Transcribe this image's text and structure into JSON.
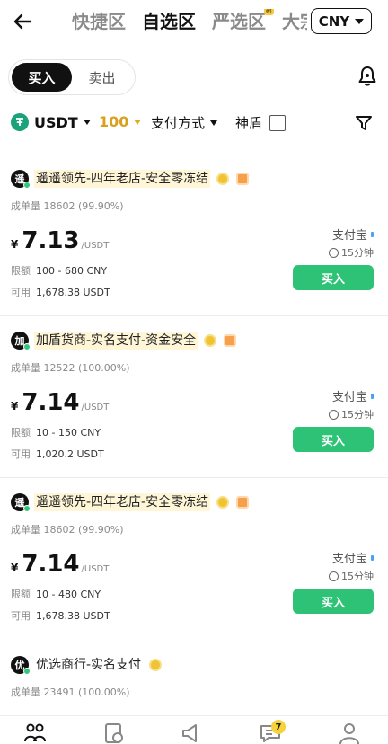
{
  "header": {
    "tabs": [
      {
        "label": "快捷区",
        "active": false
      },
      {
        "label": "自选区",
        "active": true
      },
      {
        "label": "严选区",
        "active": false,
        "badge": "新"
      },
      {
        "label": "大宗",
        "active": false
      }
    ],
    "currency": "CNY"
  },
  "trade_toggle": {
    "buy": "买入",
    "sell": "卖出",
    "selected": "买入"
  },
  "filters": {
    "coin": "USDT",
    "amount": "100",
    "payment": "支付方式",
    "shield": "神盾",
    "shield_checked": false
  },
  "listings": [
    {
      "avatar": "遥",
      "name": "遥遥领先-四年老店-安全零冻结",
      "highlight": true,
      "orange_badge": true,
      "deals_label": "成单量",
      "deals": "18602 (99.90%)",
      "currency_symbol": "¥",
      "price": "7.13",
      "unit": "/USDT",
      "limit_label": "限额",
      "limit": "100 - 680 CNY",
      "available_label": "可用",
      "available": "1,678.38 USDT",
      "payment": "支付宝",
      "time": "15分钟",
      "button": "买入"
    },
    {
      "avatar": "加",
      "name": "加盾货商-实名支付-资金安全",
      "highlight": true,
      "orange_badge": true,
      "deals_label": "成单量",
      "deals": "12522 (100.00%)",
      "currency_symbol": "¥",
      "price": "7.14",
      "unit": "/USDT",
      "limit_label": "限额",
      "limit": "10 - 150 CNY",
      "available_label": "可用",
      "available": "1,020.2 USDT",
      "payment": "支付宝",
      "time": "15分钟",
      "button": "买入"
    },
    {
      "avatar": "遥",
      "name": "遥遥领先-四年老店-安全零冻结",
      "highlight": true,
      "orange_badge": true,
      "deals_label": "成单量",
      "deals": "18602 (99.90%)",
      "currency_symbol": "¥",
      "price": "7.14",
      "unit": "/USDT",
      "limit_label": "限额",
      "limit": "10 - 480 CNY",
      "available_label": "可用",
      "available": "1,678.38 USDT",
      "payment": "支付宝",
      "time": "15分钟",
      "button": "买入"
    },
    {
      "avatar": "优",
      "name": "优选商行-实名支付",
      "highlight": false,
      "orange_badge": false,
      "deals_label": "成单量",
      "deals": "23491 (100.00%)"
    }
  ],
  "bottom_nav": {
    "items": [
      "p2p-home-icon",
      "orders-icon",
      "ads-icon",
      "chat-icon",
      "profile-icon"
    ],
    "chat_badge": "7"
  },
  "colors": {
    "accent_green": "#2ec277",
    "gold": "#d9a01c"
  }
}
